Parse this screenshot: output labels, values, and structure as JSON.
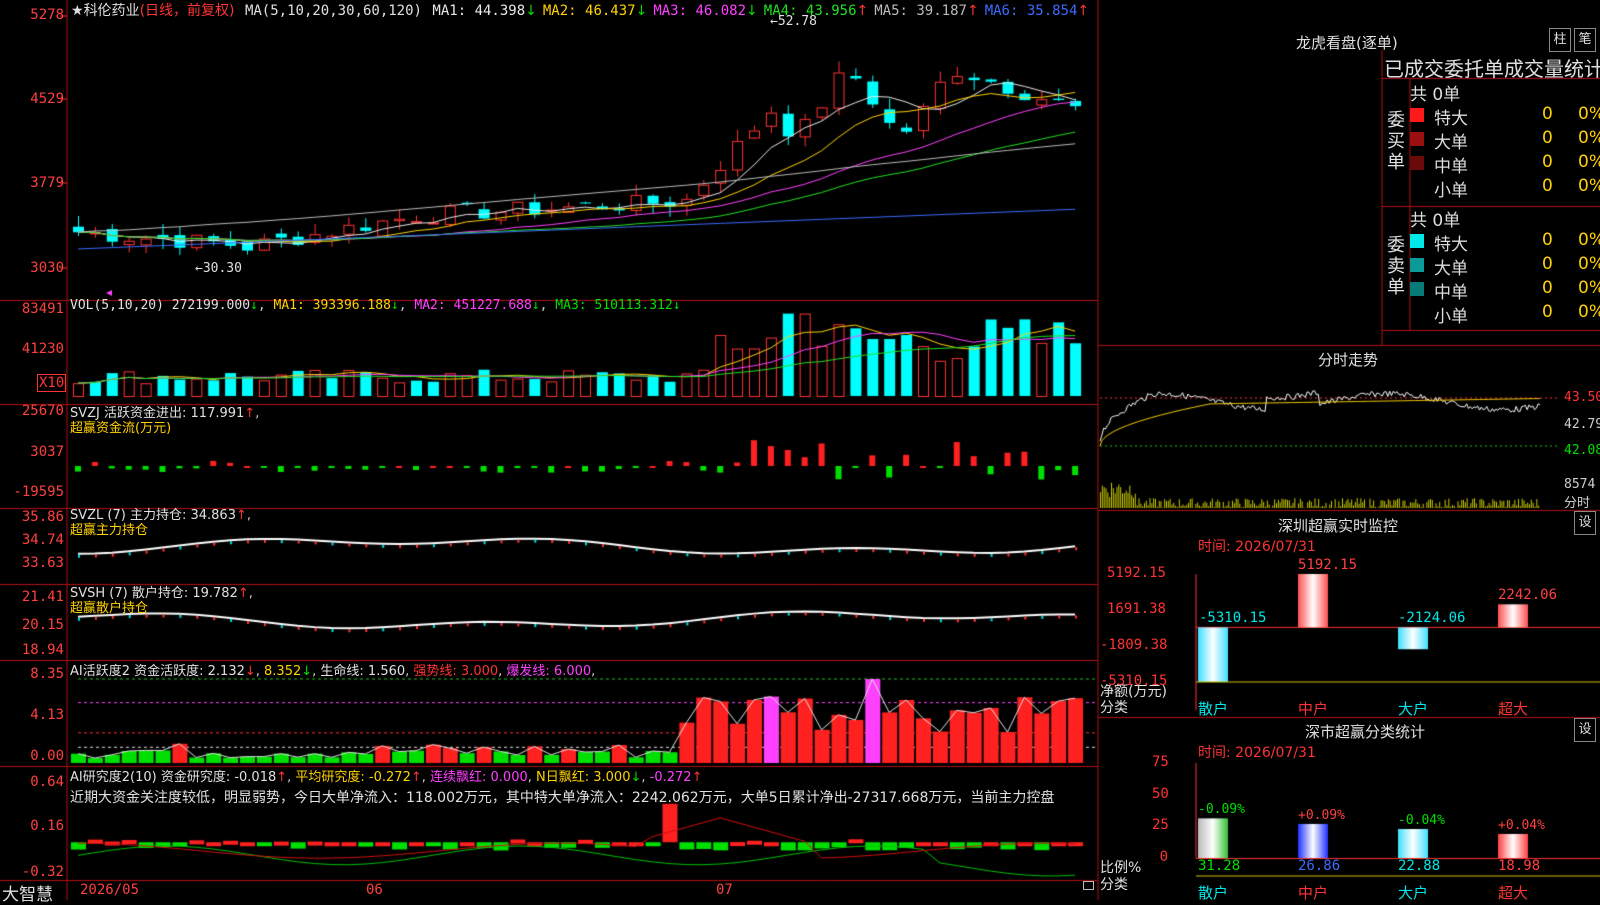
{
  "stock": {
    "name": "科伦药业",
    "period_label": "(日线，前复权)",
    "star": "★"
  },
  "ma_line": {
    "label": "MA(5,10,20,30,60,120)",
    "items": [
      {
        "label": "MA1: 44.398",
        "arrow": "↓",
        "color": "#e8e8e8"
      },
      {
        "label": "MA2: 46.437",
        "arrow": "↓",
        "color": "#ffd200"
      },
      {
        "label": "MA3: 46.082",
        "arrow": "↓",
        "color": "#ff40ff"
      },
      {
        "label": "MA4: 43.956",
        "arrow": "↑",
        "color": "#20e020"
      },
      {
        "label": "MA5: 39.187",
        "arrow": "↑",
        "color": "#bbbbbb"
      },
      {
        "label": "MA6: 35.854",
        "arrow": "↑",
        "color": "#3b6bff"
      }
    ]
  },
  "price_axis": [
    "5278",
    "4529",
    "3779",
    "3030"
  ],
  "price_marks": {
    "high": "52.78",
    "low": "30.30"
  },
  "vol": {
    "label": "VOL(5,10,20)",
    "value": "272199.000",
    "ma1": "MA1: 393396.188",
    "ma2": "MA2: 451227.688",
    "ma3": "MA3: 510113.312",
    "axis": [
      "83491",
      "41230"
    ],
    "unit": "X10"
  },
  "svzj": {
    "title": "SVZJ  活跃资金进出: 117.991",
    "sub": "超赢资金流(万元)",
    "axis": [
      "25670",
      "3037",
      "-19595"
    ]
  },
  "svzl": {
    "title": "SVZL (7) 主力持仓: 34.863",
    "sub": "超赢主力持仓",
    "axis": [
      "35.86",
      "34.74",
      "33.63"
    ]
  },
  "svsh": {
    "title": "SVSH (7) 散户持仓: 19.782",
    "sub": "超赢散户持仓",
    "axis": [
      "21.41",
      "20.15",
      "18.94"
    ]
  },
  "ai1": {
    "title": "AI活跃度2 资金活跃度: 2.132",
    "v2": "8.352",
    "life": "生命线: 1.560",
    "strong": "强势线: 3.000",
    "burst": "爆发线: 6.000",
    "axis": [
      "8.35",
      "4.13",
      "0.00"
    ]
  },
  "ai2": {
    "title": "AI研究度2(10) 资金研究度: -0.018",
    "avg": "平均研究度: -0.272",
    "cont": "连续飘红: 0.000",
    "nday": "N日飘红: 3.000",
    "tail": "-0.272",
    "comment": "近期大资金关注度较低，明显弱势，今日大单净流入：118.002万元，其中特大单净流入：2242.062万元，大单5日累计净出-27317.668万元，当前主力控盘",
    "axis": [
      "0.64",
      "0.16",
      "-0.32"
    ]
  },
  "bottom": {
    "brand": "大智慧",
    "dates": [
      "2026/05",
      "06",
      "07"
    ]
  },
  "right": {
    "dragon_title": "龙虎看盘(逐单)",
    "btn_bar": "柱",
    "btn_pen": "笔",
    "stats_header": "已成交委托单成交量统计",
    "buy_side": "委买单",
    "sell_side": "委卖单",
    "buy_total": "共 0单",
    "sell_total": "共 0单",
    "buy_rows": [
      {
        "name": "特大",
        "count": "0",
        "pct": "0%",
        "color": "#ff1a1a"
      },
      {
        "name": "大单",
        "count": "0",
        "pct": "0%",
        "color": "#9a1010"
      },
      {
        "name": "中单",
        "count": "0",
        "pct": "0%",
        "color": "#6a0a0a"
      },
      {
        "name": "小单",
        "count": "0",
        "pct": "0%",
        "color": ""
      }
    ],
    "sell_rows": [
      {
        "name": "特大",
        "count": "0",
        "pct": "0%",
        "color": "#00e8e8"
      },
      {
        "name": "大单",
        "count": "0",
        "pct": "0%",
        "color": "#0a9a9a"
      },
      {
        "name": "中单",
        "count": "0",
        "pct": "0%",
        "color": "#077a7a"
      },
      {
        "name": "小单",
        "count": "0",
        "pct": "0%",
        "color": ""
      }
    ],
    "timeline_title": "分时走势",
    "timeline_axis": [
      "43.50",
      "42.79",
      "42.08",
      "8574",
      "分时"
    ],
    "monitor_title": "深圳超赢实时监控",
    "monitor_set": "设",
    "monitor_time": "时间: 2026/07/31",
    "monitor_axis": [
      "5192.15",
      "1691.38",
      "-1809.38",
      "-5310.15"
    ],
    "monitor_unit": "净额(万元)",
    "monitor_cat": "分类",
    "class_title": "深市超赢分类统计",
    "class_set": "设",
    "class_time": "时间: 2026/07/31",
    "class_axis": [
      "75",
      "50",
      "25",
      "0"
    ],
    "class_unit": "比例%",
    "class_cat": "分类"
  },
  "chart_data": [
    {
      "type": "bar",
      "title": "深圳超赢实时监控",
      "ylabel": "净额(万元)",
      "categories": [
        "散户",
        "中户",
        "大户",
        "超大"
      ],
      "values": [
        -5310.15,
        5192.15,
        -2124.06,
        2242.06
      ],
      "labels": [
        "-5310.15",
        "5192.15",
        "-2124.06",
        "2242.06"
      ],
      "ylim": [
        -5310.15,
        5192.15
      ]
    },
    {
      "type": "bar",
      "title": "深市超赢分类统计",
      "ylabel": "比例%",
      "categories": [
        "散户",
        "中户",
        "大户",
        "超大"
      ],
      "values": [
        31.28,
        26.86,
        22.88,
        18.98
      ],
      "labels": [
        "31.28",
        "26.86",
        "22.88",
        "18.98"
      ],
      "changes": [
        "-0.09%",
        "+0.09%",
        "-0.04%",
        "+0.04%"
      ],
      "ylim": [
        0,
        75
      ]
    }
  ]
}
